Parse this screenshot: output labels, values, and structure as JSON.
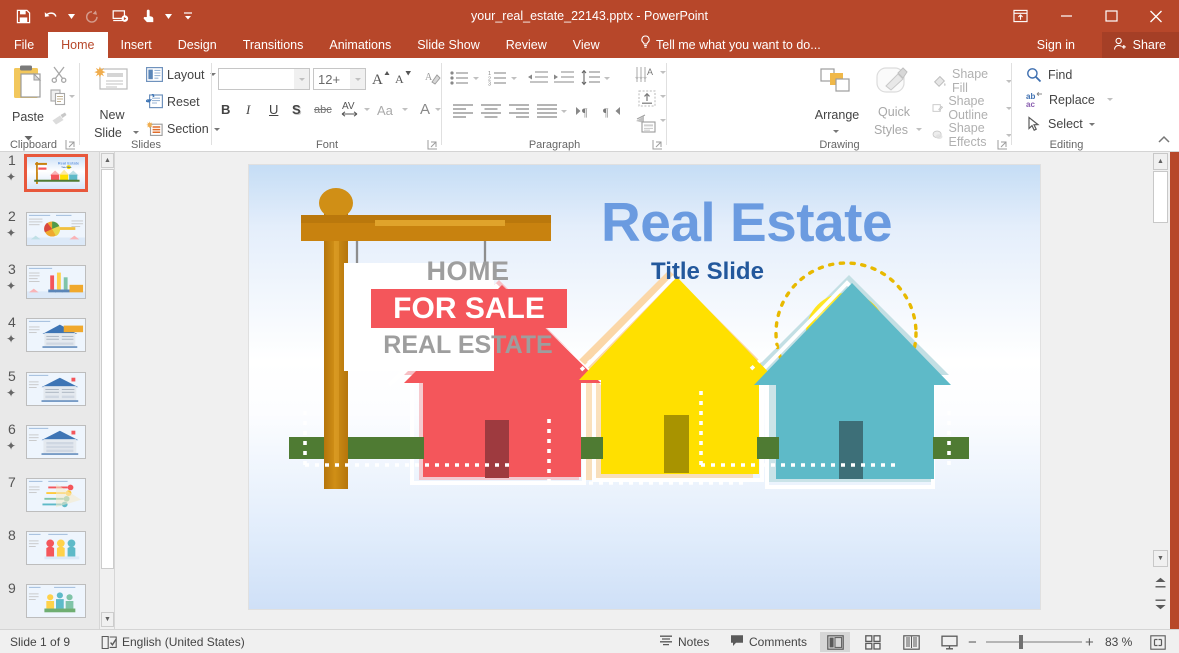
{
  "window": {
    "title": "your_real_estate_22143.pptx - PowerPoint",
    "quick_access": [
      {
        "name": "save",
        "icon": "save-icon"
      },
      {
        "name": "undo",
        "icon": "undo-icon"
      },
      {
        "name": "redo",
        "icon": "redo-icon"
      },
      {
        "name": "start-from-beginning",
        "icon": "slideshow-icon"
      },
      {
        "name": "touch-mouse-mode",
        "icon": "touch-icon"
      },
      {
        "name": "customize-qat",
        "icon": "chevron-down-icon"
      }
    ],
    "controls": {
      "ribbon_display": "ribbon-display-options-icon",
      "minimize": "minimize-icon",
      "restore": "restore-icon",
      "close": "close-icon"
    }
  },
  "tabs": [
    {
      "label": "File",
      "active": false
    },
    {
      "label": "Home",
      "active": true
    },
    {
      "label": "Insert",
      "active": false
    },
    {
      "label": "Design",
      "active": false
    },
    {
      "label": "Transitions",
      "active": false
    },
    {
      "label": "Animations",
      "active": false
    },
    {
      "label": "Slide Show",
      "active": false
    },
    {
      "label": "Review",
      "active": false
    },
    {
      "label": "View",
      "active": false
    }
  ],
  "tellme": {
    "label": "Tell me what you want to do..."
  },
  "account": {
    "signin": "Sign in",
    "share": "Share"
  },
  "ribbon": {
    "clipboard": {
      "label": "Clipboard",
      "paste": "Paste",
      "cut": "cut-icon",
      "copy": "copy-icon",
      "format_painter": "format-painter-icon"
    },
    "slides": {
      "label": "Slides",
      "new_slide": "New Slide",
      "new_slide_line1": "New",
      "new_slide_line2": "Slide",
      "layout": "Layout",
      "reset": "Reset",
      "section": "Section"
    },
    "font": {
      "label": "Font",
      "font_name": "",
      "font_name_placeholder": "",
      "font_size": "12+",
      "grow_font": "A",
      "shrink_font": "A",
      "clear_formatting": "clear-formatting-icon",
      "bold": "B",
      "italic": "I",
      "underline": "U",
      "shadow": "S",
      "strikethrough": "abc",
      "character_spacing": "AV",
      "change_case": "Aa",
      "font_color": "A"
    },
    "paragraph": {
      "label": "Paragraph",
      "bullets": "bullets-icon",
      "numbering": "numbering-icon",
      "decrease_indent": "decrease-indent-icon",
      "increase_indent": "increase-indent-icon",
      "line_spacing": "line-spacing-icon",
      "align_left": "align-left-icon",
      "align_center": "align-center-icon",
      "align_right": "align-right-icon",
      "justify": "justify-icon",
      "text_direction": "text-direction-icon",
      "align_text": "align-text-icon",
      "columns": "columns-icon",
      "smartart": "convert-to-smartart-icon"
    },
    "drawing": {
      "label": "Drawing",
      "arrange": "Arrange",
      "quick_styles_line1": "Quick",
      "quick_styles_line2": "Styles",
      "shape_fill": "Shape Fill",
      "shape_outline": "Shape Outline",
      "shape_effects": "Shape Effects"
    },
    "editing": {
      "label": "Editing",
      "find": "Find",
      "replace": "Replace",
      "select": "Select",
      "collapse_ribbon": "collapse-ribbon-icon"
    }
  },
  "thumbnails": {
    "selected_index": 1,
    "slides": [
      {
        "number": "1",
        "animated": true,
        "kind": "title"
      },
      {
        "number": "2",
        "animated": true,
        "kind": "pie-key"
      },
      {
        "number": "3",
        "animated": true,
        "kind": "bars"
      },
      {
        "number": "4",
        "animated": true,
        "kind": "house-callout"
      },
      {
        "number": "5",
        "animated": true,
        "kind": "house-two-col"
      },
      {
        "number": "6",
        "animated": true,
        "kind": "house-rows"
      },
      {
        "number": "7",
        "animated": false,
        "kind": "keys"
      },
      {
        "number": "8",
        "animated": false,
        "kind": "people"
      },
      {
        "number": "9",
        "animated": false,
        "kind": "people-bags"
      }
    ]
  },
  "slide": {
    "title": "Real Estate",
    "subtitle": "Title Slide",
    "sign": {
      "top_text": "HOME",
      "banner_text": "FOR SALE",
      "bottom_text": "REAL ESTATE"
    },
    "colors": {
      "title": "#6b9be0",
      "subtitle": "#23589c",
      "sign_banner": "#f4565b",
      "post": "#c8820f",
      "grass": "#4f7b33",
      "house_red": "#f4565b",
      "house_yellow": "#ffe000",
      "house_teal": "#5ebac8",
      "sun": "#ffdd00"
    }
  },
  "status": {
    "slide_count_label": "Slide 1 of 9",
    "language": "English (United States)",
    "notes": "Notes",
    "comments": "Comments",
    "zoom_level": "83 %",
    "zoom_out": "−",
    "zoom_in": "+",
    "views": [
      {
        "name": "normal-view",
        "active": true
      },
      {
        "name": "slide-sorter-view",
        "active": false
      },
      {
        "name": "reading-view",
        "active": false
      },
      {
        "name": "slideshow-view",
        "active": false
      }
    ],
    "fit_slide": "fit-slide-to-window-icon"
  }
}
